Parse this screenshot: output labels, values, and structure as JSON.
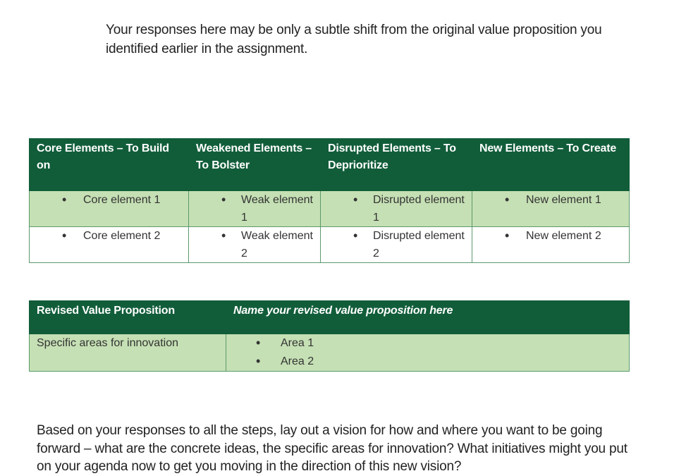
{
  "intro_text": "Your responses here may be only a subtle shift from the original value proposition you identified earlier in the assignment.",
  "elements_table": {
    "headers": [
      "Core Elements – To Build on",
      "Weakened Elements – To Bolster",
      "Disrupted Elements – To Deprioritize",
      "New Elements – To Create"
    ],
    "rows": [
      [
        "Core element 1",
        "Weak element 1",
        "Disrupted element 1",
        "New element 1"
      ],
      [
        "Core element 2",
        "Weak element 2",
        "Disrupted element 2",
        "New element 2"
      ]
    ]
  },
  "value_prop_table": {
    "header_label": "Revised Value Proposition",
    "header_placeholder": "Name your revised value proposition here",
    "row_label": "Specific areas for innovation",
    "areas": [
      "Area 1",
      "Area 2"
    ]
  },
  "outro_text": "Based on your responses to all the steps, lay out a vision for how and where you want to be going forward – what are the concrete ideas, the specific areas for innovation? What initiatives might you put on your agenda now to get you moving in the direction of this new vision?",
  "colors": {
    "header_green": "#115d3a",
    "row_green": "#c5e0b4"
  }
}
